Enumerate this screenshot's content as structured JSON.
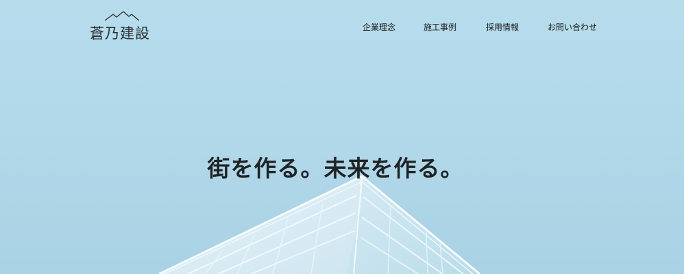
{
  "logo": {
    "text": "蒼乃建設",
    "icon": "mountain-icon"
  },
  "nav": {
    "items": [
      {
        "label": "企業理念"
      },
      {
        "label": "施工事例"
      },
      {
        "label": "採用情報"
      },
      {
        "label": "お問い合わせ"
      }
    ]
  },
  "hero": {
    "headline": "街を作る。未来を作る。",
    "sky_color": "#b3daeb"
  }
}
